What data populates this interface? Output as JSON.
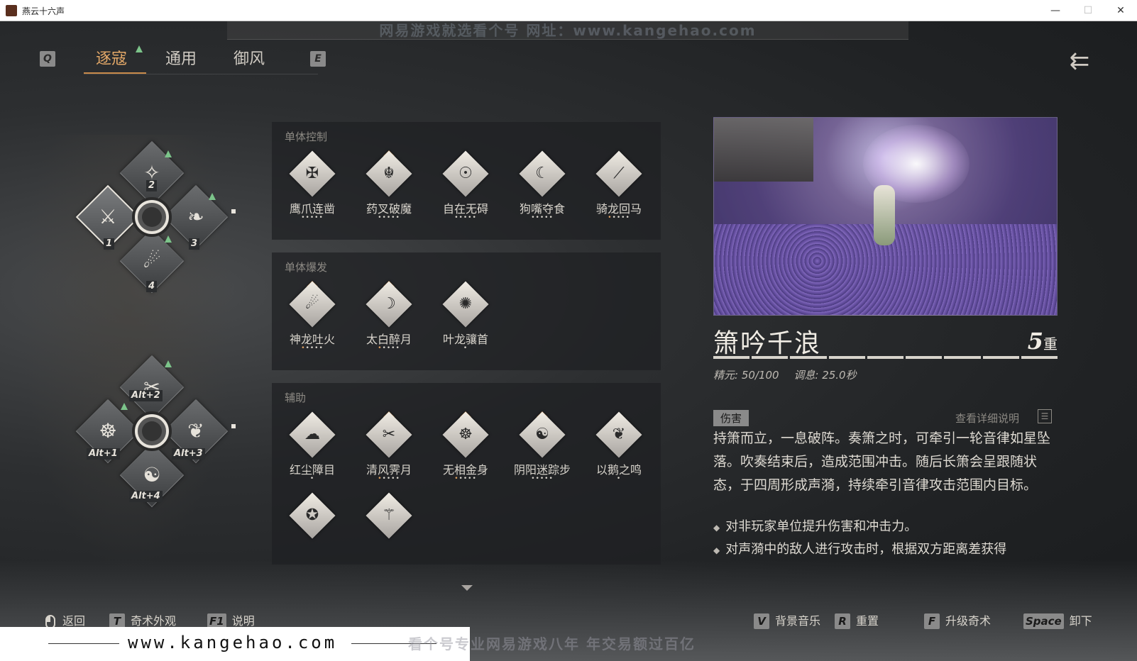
{
  "window": {
    "title": "燕云十六声",
    "minimize": "—",
    "maximize": "☐",
    "close": "✕"
  },
  "watermark_top": "网易游戏就选看个号 网址：www.kangehao.com",
  "tabs": {
    "prev_key": "Q",
    "next_key": "E",
    "items": [
      {
        "label": "逐寇",
        "active": true
      },
      {
        "label": "通用",
        "active": false
      },
      {
        "label": "御风",
        "active": false
      }
    ]
  },
  "back_icon": "double-chevron-left-arrow",
  "wheel_top": {
    "slots": [
      {
        "num": "1",
        "glyph": "⚔",
        "selected": true
      },
      {
        "num": "2",
        "glyph": "✧"
      },
      {
        "num": "3",
        "glyph": "❧"
      },
      {
        "num": "4",
        "glyph": "☄"
      }
    ]
  },
  "wheel_bottom": {
    "slots": [
      {
        "num": "Alt+1",
        "glyph": "☸"
      },
      {
        "num": "Alt+2",
        "glyph": "✂"
      },
      {
        "num": "Alt+3",
        "glyph": "❦"
      },
      {
        "num": "Alt+4",
        "glyph": "☯"
      }
    ]
  },
  "categories": [
    {
      "title": "单体控制",
      "skills": [
        {
          "name": "鹰爪连凿",
          "glyph": "✠",
          "dots": "•••••",
          "active_dots": 0,
          "upgradable": false
        },
        {
          "name": "药叉破魔",
          "glyph": "☬",
          "dots": "•••••",
          "active_dots": 0,
          "upgradable": true
        },
        {
          "name": "自在无碍",
          "glyph": "☉",
          "dots": "•••••",
          "active_dots": 0,
          "upgradable": false
        },
        {
          "name": "狗嘴夺食",
          "glyph": "☾",
          "dots": "•••••",
          "active_dots": 0,
          "upgradable": false
        },
        {
          "name": "骑龙回马",
          "glyph": "⟋",
          "dots": "•••••",
          "active_dots": 1,
          "upgradable": false
        }
      ]
    },
    {
      "title": "单体爆发",
      "skills": [
        {
          "name": "神龙吐火",
          "glyph": "☄",
          "dots": "•••••",
          "active_dots": 1,
          "upgradable": true
        },
        {
          "name": "太白醉月",
          "glyph": "☽",
          "dots": "•••••",
          "active_dots": 1,
          "upgradable": true
        },
        {
          "name": "叶龙骧首",
          "glyph": "✺",
          "dots": "•",
          "active_dots": 0,
          "upgradable": false
        }
      ]
    },
    {
      "title": "辅助",
      "skills": [
        {
          "name": "红尘障目",
          "glyph": "☁",
          "dots": "•",
          "active_dots": 0,
          "upgradable": false
        },
        {
          "name": "清风霁月",
          "glyph": "✂",
          "dots": "•••••",
          "active_dots": 1,
          "upgradable": true
        },
        {
          "name": "无相金身",
          "glyph": "☸",
          "dots": "•••••",
          "active_dots": 1,
          "upgradable": true
        },
        {
          "name": "阴阳迷踪步",
          "glyph": "☯",
          "dots": "•••••",
          "active_dots": 0,
          "upgradable": true
        },
        {
          "name": "以鹅之鸣",
          "glyph": "❦",
          "dots": "•",
          "active_dots": 0,
          "upgradable": false
        },
        {
          "name": "",
          "glyph": "✪",
          "dots": "",
          "active_dots": 0,
          "upgradable": false
        },
        {
          "name": "",
          "glyph": "⚚",
          "dots": "",
          "active_dots": 0,
          "upgradable": false
        }
      ]
    }
  ],
  "detail": {
    "title": "箫吟千浪",
    "level": "5",
    "level_unit": "重",
    "level_progress": 1.0,
    "stat_essence": "精元: 50/100",
    "stat_breath": "调息: 25.0秒",
    "tag": "伤害",
    "detail_link": "查看详细说明",
    "description": "持箫而立，一息破阵。奏箫之时，可牵引一轮音律如星坠落。吹奏结束后，造成范围冲击。随后长箫会呈跟随状态，于四周形成声漪，持续牵引音律攻击范围内目标。",
    "bullets": [
      "对非玩家单位提升伤害和冲击力。",
      "对声漪中的敌人进行攻击时，根据双方距离差获得"
    ]
  },
  "hints_left": [
    {
      "key": "mouse",
      "label": "返回"
    },
    {
      "key": "T",
      "label": "奇术外观"
    },
    {
      "key": "F1",
      "label": "说明"
    }
  ],
  "hints_right": [
    {
      "key": "V",
      "label": "背景音乐"
    },
    {
      "key": "R",
      "label": "重置"
    },
    {
      "key": "F",
      "label": "升级奇术"
    },
    {
      "key": "Space",
      "label": "卸下"
    }
  ],
  "watermark_bottom": {
    "url": "www.kangehao.com",
    "slogan": "看个号专业网易游戏八年 年交易额过百亿"
  },
  "colors": {
    "accent": "#e3a868",
    "upgrade": "#7cc48a",
    "panel": "#1e2022"
  }
}
